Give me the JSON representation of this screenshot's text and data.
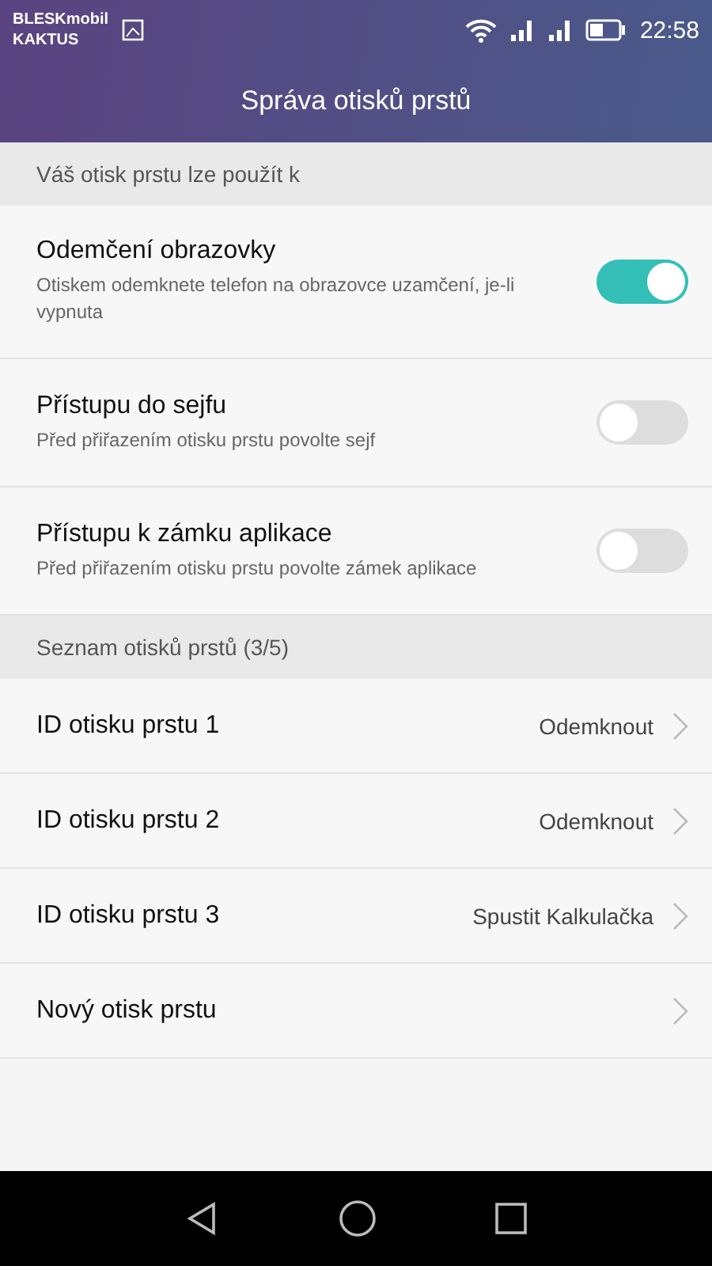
{
  "status_bar": {
    "carrier_line_1": "BLESKmobil",
    "carrier_line_2": "KAKTUS",
    "time": "22:58"
  },
  "title": "Správa otisků prstů",
  "sections": [
    {
      "header": "Váš otisk prstu lze použít k",
      "kind": "toggles",
      "items": [
        {
          "title": "Odemčení obrazovky",
          "subtitle": "Otiskem odemknete telefon na obrazovce uzamčení, je-li vypnuta",
          "on": true
        },
        {
          "title": "Přístupu do sejfu",
          "subtitle": "Před přiřazením otisku prstu povolte sejf",
          "on": false
        },
        {
          "title": "Přístupu k zámku aplikace",
          "subtitle": "Před přiřazením otisku prstu povolte zámek aplikace",
          "on": false
        }
      ]
    },
    {
      "header": "Seznam otisků prstů (3/5)",
      "kind": "links",
      "items": [
        {
          "title": "ID otisku prstu 1",
          "value": "Odemknout"
        },
        {
          "title": "ID otisku prstu 2",
          "value": "Odemknout"
        },
        {
          "title": "ID otisku prstu 3",
          "value": "Spustit Kalkulačka"
        },
        {
          "title": "Nový otisk prstu"
        }
      ]
    }
  ]
}
